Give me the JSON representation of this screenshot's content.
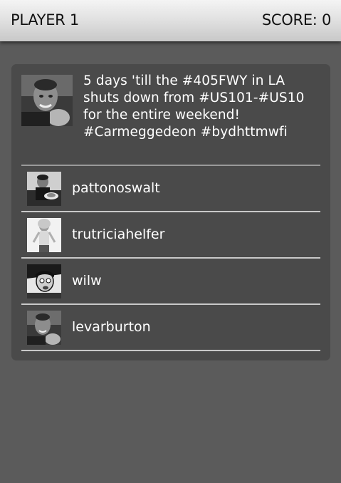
{
  "header": {
    "player_label": "PLAYER 1",
    "score_label": "SCORE: 0"
  },
  "tweet": {
    "text": "5 days 'till the #405FWY in LA shuts down from #US101-#US10 for the entire weekend! #Carmeggedeon #bydhttmwfi",
    "avatar_icon": "user-photo-avatar"
  },
  "options": [
    {
      "username": "pattonoswalt",
      "avatar_icon": "patton-avatar"
    },
    {
      "username": "trutriciahelfer",
      "avatar_icon": "tricia-avatar"
    },
    {
      "username": "wilw",
      "avatar_icon": "wilw-cartoon-avatar"
    },
    {
      "username": "levarburton",
      "avatar_icon": "levar-avatar"
    }
  ],
  "colors": {
    "background": "#5b5b5b",
    "card": "#4a4a4a",
    "text": "#ffffff",
    "divider": "#c9c9c9"
  }
}
